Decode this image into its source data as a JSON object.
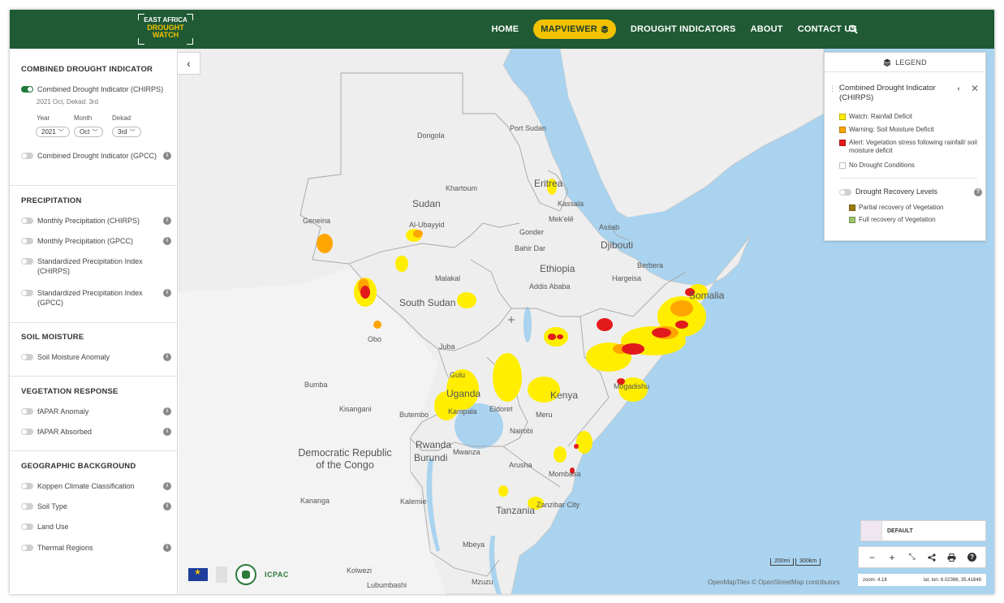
{
  "header": {
    "logo": {
      "line1": "EAST AFRICA",
      "line2": "DROUGHT",
      "line3": "WATCH"
    },
    "nav": [
      {
        "label": "HOME"
      },
      {
        "label": "MAPVIEWER"
      },
      {
        "label": "DROUGHT INDICATORS"
      },
      {
        "label": "ABOUT"
      },
      {
        "label": "CONTACT US"
      }
    ],
    "active_nav": "MAPVIEWER",
    "search_icon": "search-icon",
    "color": "#1f5a34",
    "accent": "#f2c100"
  },
  "sidebar": {
    "sections": [
      {
        "title": "COMBINED DROUGHT INDICATOR"
      },
      {
        "title": "PRECIPITATION"
      },
      {
        "title": "SOIL MOISTURE"
      },
      {
        "title": "VEGETATION RESPONSE"
      },
      {
        "title": "GEOGRAPHIC BACKGROUND"
      }
    ],
    "cdi_chirps": {
      "label": "Combined Drought Indicator (CHIRPS)",
      "date": "2021 Oct, Dekad: 3rd",
      "enabled": true
    },
    "selectors": {
      "year_label": "Year",
      "year_value": "2021",
      "month_label": "Month",
      "month_value": "Oct",
      "dekad_label": "Dekad",
      "dekad_value": "3rd"
    },
    "cdi_gpcc": {
      "label": "Combined Drought Indicator (GPCC)"
    },
    "precipitation": [
      {
        "label": "Monthly Precipitation (CHIRPS)"
      },
      {
        "label": "Monthly Precipitation (GPCC)"
      },
      {
        "label": "Standardized Precipitation Index (CHIRPS)"
      },
      {
        "label": "Standardized Precipitation Index (GPCC)"
      }
    ],
    "soil_moisture": [
      {
        "label": "Soil Moisture Anomaly"
      }
    ],
    "vegetation": [
      {
        "label": "fAPAR Anomaly"
      },
      {
        "label": "fAPAR Absorbed"
      }
    ],
    "geographic": [
      {
        "label": "Koppen Climate Classification"
      },
      {
        "label": "Soil Type"
      },
      {
        "label": "Land Use"
      },
      {
        "label": "Thermal Regions"
      }
    ],
    "partners": {
      "icpac": "ICPAC"
    }
  },
  "map": {
    "places": {
      "sudan": "Sudan",
      "south_sudan": "South Sudan",
      "eritrea": "Eritrea",
      "ethiopia": "Ethiopia",
      "djibouti": "Djibouti",
      "somalia": "Somalia",
      "kenya": "Kenya",
      "uganda": "Uganda",
      "rwanda": "Rwanda",
      "burundi": "Burundi",
      "tanzania": "Tanzania",
      "drc": "Democratic Republic\nof the Congo",
      "dongola": "Dongola",
      "port_sudan": "Port Sudan",
      "khartoum": "Khartoum",
      "geneina": "Geneina",
      "al_ubayyid": "Al-Ubayyid",
      "kassala": "Kassala",
      "mekele": "Mek'elē",
      "gonder": "Gonder",
      "assab": "Assab",
      "bahir_dar": "Bahir Dar",
      "berbera": "Berbera",
      "hargeisa": "Hargeisa",
      "malakal": "Malakal",
      "addis_ababa": "Addis Ababa",
      "obo": "Obo",
      "juba": "Juba",
      "gulu": "Gulu",
      "mogadishu": "Mogadishu",
      "bumba": "Bumba",
      "kisangani": "Kisangani",
      "kampala": "Kampala",
      "eldoret": "Eldoret",
      "meru": "Meru",
      "butembo": "Butembo",
      "nairobi": "Nairobi",
      "mwanza": "Mwanza",
      "arusha": "Arusha",
      "mombasa": "Mombasa",
      "kalemie": "Kalemie",
      "kananga": "Kananga",
      "zanzibar": "Zanzibar City",
      "mbeya": "Mbeya",
      "kolwezi": "Kolwezi",
      "lubumbashi": "Lubumbashi",
      "mzuzu": "Mzuzu"
    },
    "sea_color": "#a9d3ef",
    "land_color": "#eeeeee",
    "basemap_label": "DEFAULT",
    "scale": {
      "a": "200mi",
      "b": "300km"
    },
    "status": {
      "zoom": "zoom: 4.18",
      "latlon": "lat, lon: 6.02366, 35.41648"
    },
    "attribution": "OpenMapTiles  © OpenStreetMap contributors"
  },
  "legend": {
    "header": "LEGEND",
    "layer_title": "Combined Drought Indicator (CHIRPS)",
    "items": [
      {
        "label": "Watch: Rainfall Deficit",
        "color": "#ffff00"
      },
      {
        "label": "Warning: Soil Moisture Deficit",
        "color": "#ffa500"
      },
      {
        "label": "Alert: Vegetation stress following rainfall/ soil moisture deficit",
        "color": "#e31a1c"
      },
      {
        "label": "No Drought Conditions",
        "color": "#ffffff"
      }
    ],
    "recovery_title": "Drought Recovery Levels",
    "recovery_items": [
      {
        "label": "Partial recovery of Vegetation",
        "color": "#9a7a0a"
      },
      {
        "label": "Full recovery of Vegetation",
        "color": "#9bc46a"
      }
    ]
  }
}
